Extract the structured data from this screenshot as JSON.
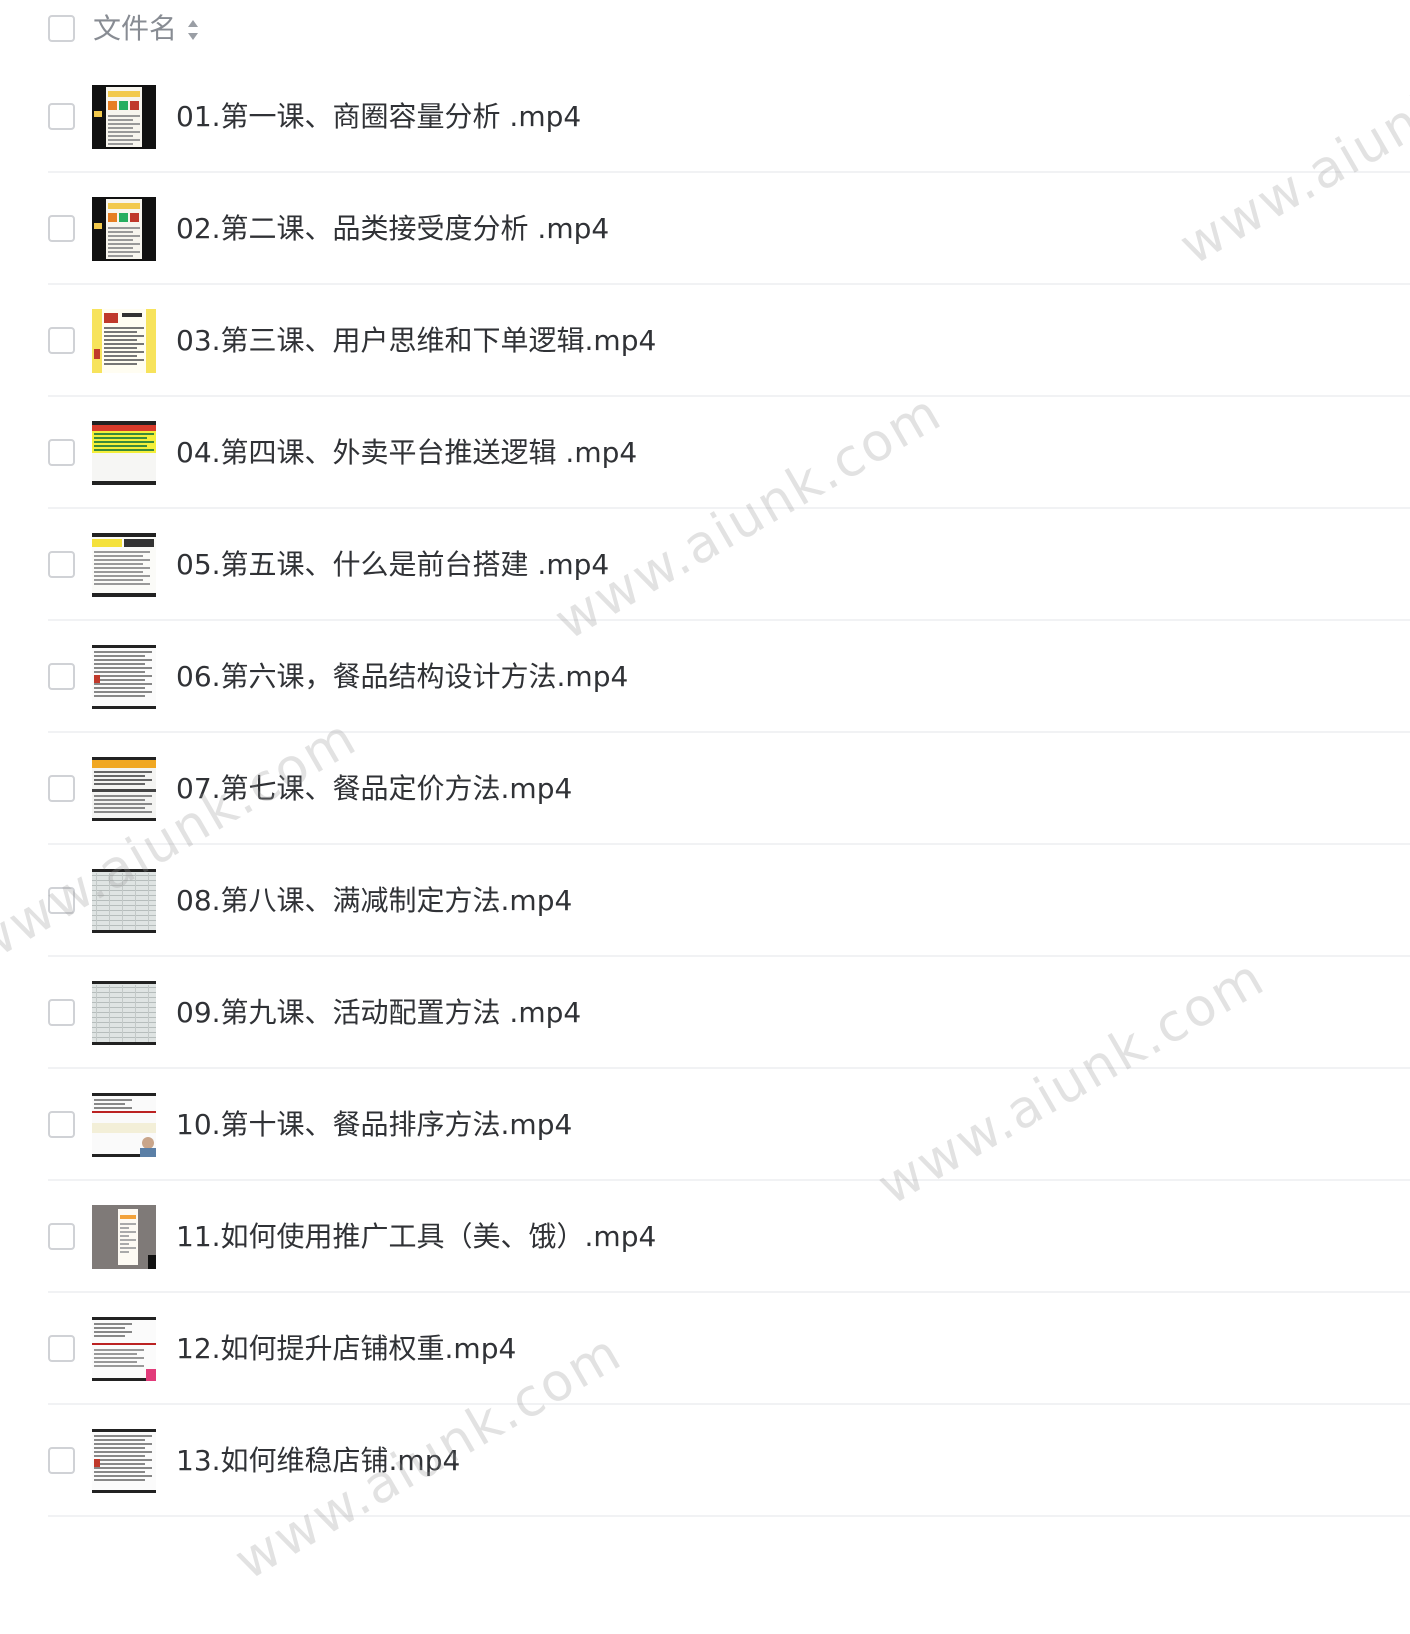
{
  "header": {
    "label": "文件名"
  },
  "files": [
    {
      "name": "01.第一课、商圈容量分析 .mp4",
      "thumb": "phone-dark"
    },
    {
      "name": "02.第二课、品类接受度分析 .mp4",
      "thumb": "phone-dark"
    },
    {
      "name": "03.第三课、用户思维和下单逻辑.mp4",
      "thumb": "phone-yellow"
    },
    {
      "name": "04.第四课、外卖平台推送逻辑 .mp4",
      "thumb": "sheet-yellow"
    },
    {
      "name": "05.第五课、什么是前台搭建 .mp4",
      "thumb": "doc-yellow"
    },
    {
      "name": "06.第六课，餐品结构设计方法.mp4",
      "thumb": "doc-white"
    },
    {
      "name": "07.第七课、餐品定价方法.mp4",
      "thumb": "doc-orange"
    },
    {
      "name": "08.第八课、满减制定方法.mp4",
      "thumb": "sheet-gray"
    },
    {
      "name": "09.第九课、活动配置方法 .mp4",
      "thumb": "sheet-gray"
    },
    {
      "name": "10.第十课、餐品排序方法.mp4",
      "thumb": "doc-person"
    },
    {
      "name": "11.如何使用推广工具（美、饿）.mp4",
      "thumb": "gray-phone"
    },
    {
      "name": "12.如何提升店铺权重.mp4",
      "thumb": "doc-pink"
    },
    {
      "name": "13.如何维稳店铺.mp4",
      "thumb": "doc-white"
    }
  ],
  "watermarks": [
    "www.aiunk.com",
    "www.aiunk.com",
    "www.aiunk.com",
    "www.aiunk.com",
    "www.aiunk.com"
  ],
  "colors": {
    "text": "#303236",
    "header_text": "#888c93",
    "checkbox_border": "#d0d2d6",
    "divider": "#f1f2f4"
  }
}
